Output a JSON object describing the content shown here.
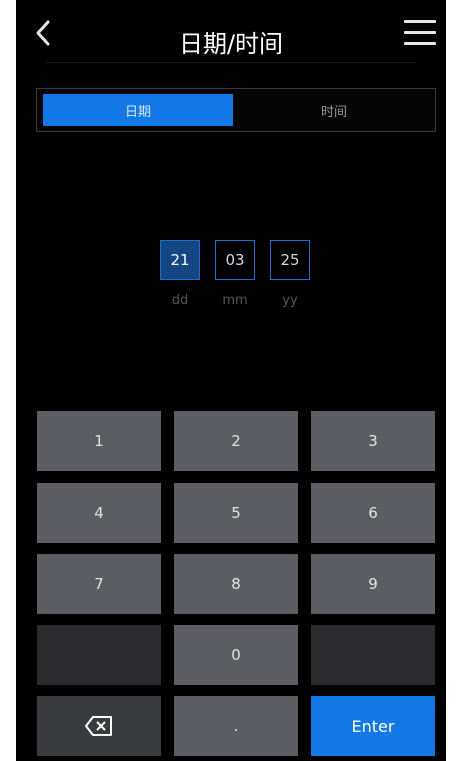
{
  "header": {
    "title": "日期/时间"
  },
  "tabs": [
    {
      "label": "日期",
      "active": true
    },
    {
      "label": "时间",
      "active": false
    }
  ],
  "date": {
    "fields": [
      {
        "value": "21",
        "unit": "dd",
        "selected": true
      },
      {
        "value": "03",
        "unit": "mm",
        "selected": false
      },
      {
        "value": "25",
        "unit": "yy",
        "selected": false
      }
    ]
  },
  "keypad": {
    "keys": [
      "1",
      "2",
      "3",
      "4",
      "5",
      "6",
      "7",
      "8",
      "9",
      "0",
      "."
    ],
    "enter_label": "Enter",
    "backspace_icon": "backspace-icon"
  },
  "colors": {
    "accent": "#1278e6",
    "key_bg": "#5c5d62",
    "selected_field": "#134683",
    "background": "#000000"
  }
}
